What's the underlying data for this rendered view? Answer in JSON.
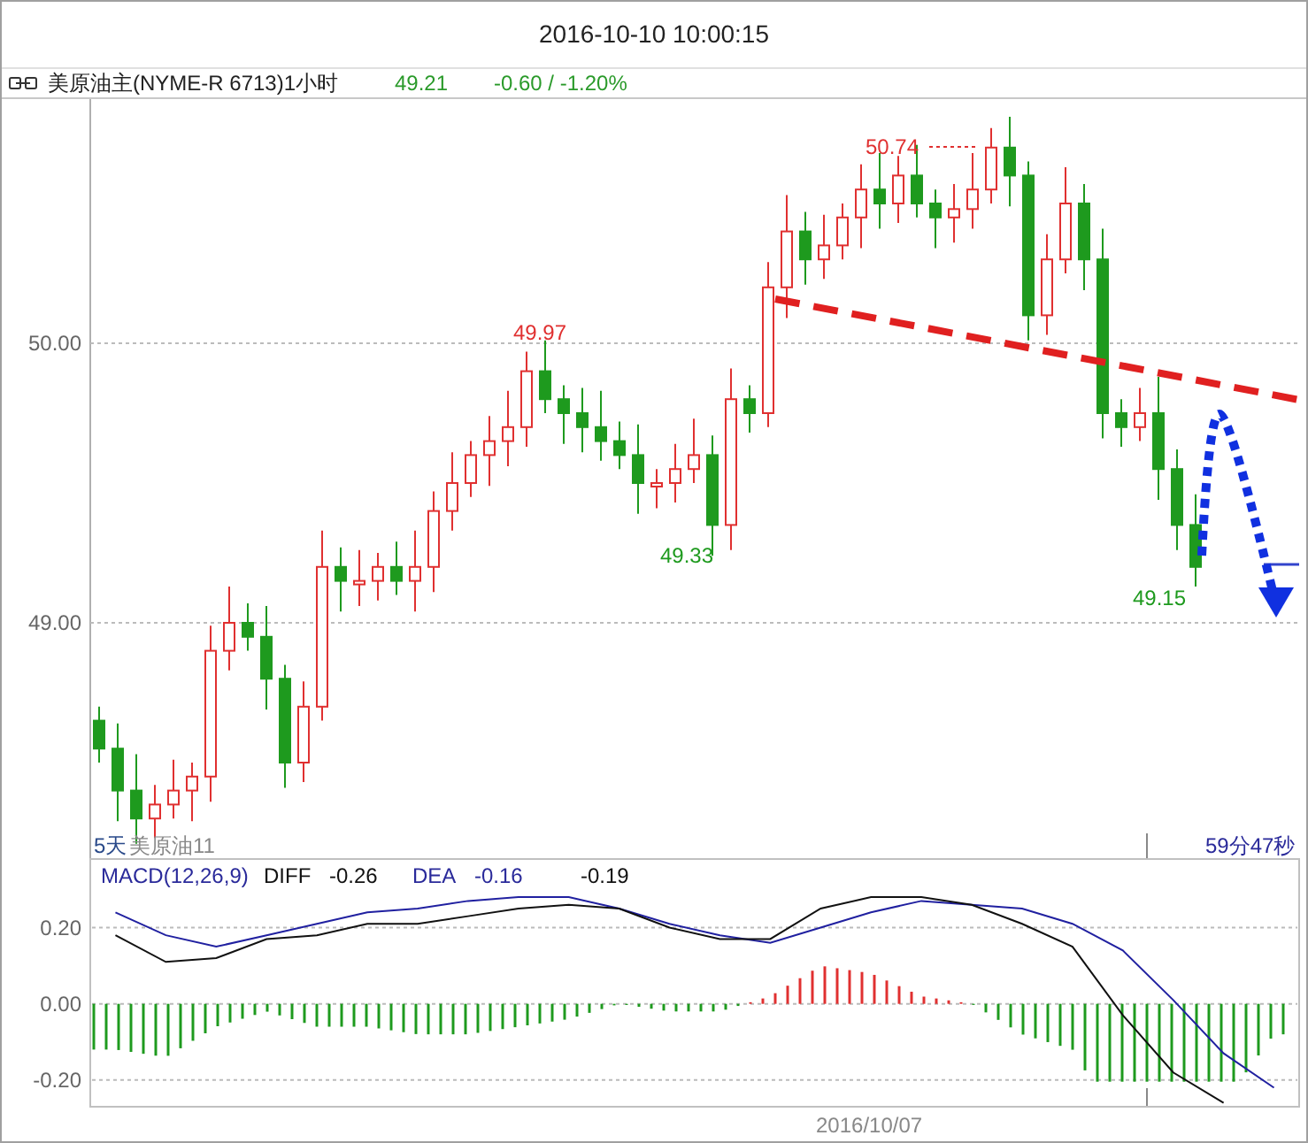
{
  "title": "2016-10-10 10:00:15",
  "instrument": {
    "name": "美原油主(NYME-R 6713)1小时",
    "price": "49.21",
    "change": "-0.60 / -1.20%"
  },
  "price_chart": {
    "y_ticks": [
      "50.00",
      "49.00"
    ],
    "annotations": [
      {
        "text": "50.74",
        "kind": "high"
      },
      {
        "text": "49.97",
        "kind": "high"
      },
      {
        "text": "49.33",
        "kind": "low"
      },
      {
        "text": "49.15",
        "kind": "low"
      }
    ],
    "period_label": "5天",
    "series_label": "美原油11",
    "countdown": "59分47秒"
  },
  "macd": {
    "name": "MACD(12,26,9)",
    "diff": "-0.26",
    "dea": "-0.16",
    "macd": "-0.19",
    "chart_data": {
      "type": "line",
      "categories": [
        null,
        null,
        null,
        null,
        null,
        null,
        null,
        null,
        null,
        null,
        null,
        null,
        null,
        null,
        null,
        null,
        null,
        null,
        null,
        null,
        null,
        null,
        null,
        null
      ],
      "ylim": [
        -0.27,
        0.38
      ],
      "grid": true,
      "yticks": [
        {
          "value": 0.2,
          "label": "0.20"
        },
        {
          "value": 0,
          "label": "0.00"
        },
        {
          "value": -0.2,
          "label": "-0.20"
        }
      ],
      "series": [
        {
          "name": "DIFF",
          "color": "#111111",
          "values": [
            0.18,
            0.11,
            0.12,
            0.17,
            0.18,
            0.21,
            0.21,
            0.23,
            0.25,
            0.26,
            0.25,
            0.2,
            0.17,
            0.17,
            0.25,
            0.28,
            0.28,
            0.26,
            0.21,
            0.15,
            -0.03,
            -0.18,
            -0.26,
            null
          ]
        },
        {
          "name": "DEA",
          "color": "#2020a0",
          "values": [
            0.24,
            0.18,
            0.15,
            0.18,
            0.21,
            0.24,
            0.25,
            0.27,
            0.28,
            0.28,
            0.25,
            0.21,
            0.18,
            0.16,
            0.2,
            0.24,
            0.27,
            0.26,
            0.25,
            0.21,
            0.14,
            0.01,
            -0.13,
            -0.22
          ]
        }
      ]
    }
  },
  "x_axis_label": "2016/10/07"
}
